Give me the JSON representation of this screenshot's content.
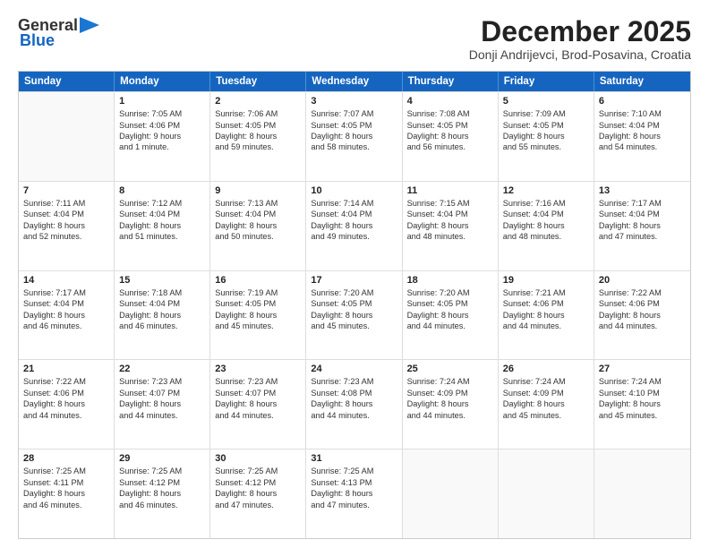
{
  "header": {
    "logo_line1": "General",
    "logo_line2": "Blue",
    "month": "December 2025",
    "location": "Donji Andrijevci, Brod-Posavina, Croatia"
  },
  "days": [
    "Sunday",
    "Monday",
    "Tuesday",
    "Wednesday",
    "Thursday",
    "Friday",
    "Saturday"
  ],
  "weeks": [
    [
      {
        "day": "",
        "content": []
      },
      {
        "day": "1",
        "content": [
          "Sunrise: 7:05 AM",
          "Sunset: 4:06 PM",
          "Daylight: 9 hours",
          "and 1 minute."
        ]
      },
      {
        "day": "2",
        "content": [
          "Sunrise: 7:06 AM",
          "Sunset: 4:05 PM",
          "Daylight: 8 hours",
          "and 59 minutes."
        ]
      },
      {
        "day": "3",
        "content": [
          "Sunrise: 7:07 AM",
          "Sunset: 4:05 PM",
          "Daylight: 8 hours",
          "and 58 minutes."
        ]
      },
      {
        "day": "4",
        "content": [
          "Sunrise: 7:08 AM",
          "Sunset: 4:05 PM",
          "Daylight: 8 hours",
          "and 56 minutes."
        ]
      },
      {
        "day": "5",
        "content": [
          "Sunrise: 7:09 AM",
          "Sunset: 4:05 PM",
          "Daylight: 8 hours",
          "and 55 minutes."
        ]
      },
      {
        "day": "6",
        "content": [
          "Sunrise: 7:10 AM",
          "Sunset: 4:04 PM",
          "Daylight: 8 hours",
          "and 54 minutes."
        ]
      }
    ],
    [
      {
        "day": "7",
        "content": [
          "Sunrise: 7:11 AM",
          "Sunset: 4:04 PM",
          "Daylight: 8 hours",
          "and 52 minutes."
        ]
      },
      {
        "day": "8",
        "content": [
          "Sunrise: 7:12 AM",
          "Sunset: 4:04 PM",
          "Daylight: 8 hours",
          "and 51 minutes."
        ]
      },
      {
        "day": "9",
        "content": [
          "Sunrise: 7:13 AM",
          "Sunset: 4:04 PM",
          "Daylight: 8 hours",
          "and 50 minutes."
        ]
      },
      {
        "day": "10",
        "content": [
          "Sunrise: 7:14 AM",
          "Sunset: 4:04 PM",
          "Daylight: 8 hours",
          "and 49 minutes."
        ]
      },
      {
        "day": "11",
        "content": [
          "Sunrise: 7:15 AM",
          "Sunset: 4:04 PM",
          "Daylight: 8 hours",
          "and 48 minutes."
        ]
      },
      {
        "day": "12",
        "content": [
          "Sunrise: 7:16 AM",
          "Sunset: 4:04 PM",
          "Daylight: 8 hours",
          "and 48 minutes."
        ]
      },
      {
        "day": "13",
        "content": [
          "Sunrise: 7:17 AM",
          "Sunset: 4:04 PM",
          "Daylight: 8 hours",
          "and 47 minutes."
        ]
      }
    ],
    [
      {
        "day": "14",
        "content": [
          "Sunrise: 7:17 AM",
          "Sunset: 4:04 PM",
          "Daylight: 8 hours",
          "and 46 minutes."
        ]
      },
      {
        "day": "15",
        "content": [
          "Sunrise: 7:18 AM",
          "Sunset: 4:04 PM",
          "Daylight: 8 hours",
          "and 46 minutes."
        ]
      },
      {
        "day": "16",
        "content": [
          "Sunrise: 7:19 AM",
          "Sunset: 4:05 PM",
          "Daylight: 8 hours",
          "and 45 minutes."
        ]
      },
      {
        "day": "17",
        "content": [
          "Sunrise: 7:20 AM",
          "Sunset: 4:05 PM",
          "Daylight: 8 hours",
          "and 45 minutes."
        ]
      },
      {
        "day": "18",
        "content": [
          "Sunrise: 7:20 AM",
          "Sunset: 4:05 PM",
          "Daylight: 8 hours",
          "and 44 minutes."
        ]
      },
      {
        "day": "19",
        "content": [
          "Sunrise: 7:21 AM",
          "Sunset: 4:06 PM",
          "Daylight: 8 hours",
          "and 44 minutes."
        ]
      },
      {
        "day": "20",
        "content": [
          "Sunrise: 7:22 AM",
          "Sunset: 4:06 PM",
          "Daylight: 8 hours",
          "and 44 minutes."
        ]
      }
    ],
    [
      {
        "day": "21",
        "content": [
          "Sunrise: 7:22 AM",
          "Sunset: 4:06 PM",
          "Daylight: 8 hours",
          "and 44 minutes."
        ]
      },
      {
        "day": "22",
        "content": [
          "Sunrise: 7:23 AM",
          "Sunset: 4:07 PM",
          "Daylight: 8 hours",
          "and 44 minutes."
        ]
      },
      {
        "day": "23",
        "content": [
          "Sunrise: 7:23 AM",
          "Sunset: 4:07 PM",
          "Daylight: 8 hours",
          "and 44 minutes."
        ]
      },
      {
        "day": "24",
        "content": [
          "Sunrise: 7:23 AM",
          "Sunset: 4:08 PM",
          "Daylight: 8 hours",
          "and 44 minutes."
        ]
      },
      {
        "day": "25",
        "content": [
          "Sunrise: 7:24 AM",
          "Sunset: 4:09 PM",
          "Daylight: 8 hours",
          "and 44 minutes."
        ]
      },
      {
        "day": "26",
        "content": [
          "Sunrise: 7:24 AM",
          "Sunset: 4:09 PM",
          "Daylight: 8 hours",
          "and 45 minutes."
        ]
      },
      {
        "day": "27",
        "content": [
          "Sunrise: 7:24 AM",
          "Sunset: 4:10 PM",
          "Daylight: 8 hours",
          "and 45 minutes."
        ]
      }
    ],
    [
      {
        "day": "28",
        "content": [
          "Sunrise: 7:25 AM",
          "Sunset: 4:11 PM",
          "Daylight: 8 hours",
          "and 46 minutes."
        ]
      },
      {
        "day": "29",
        "content": [
          "Sunrise: 7:25 AM",
          "Sunset: 4:12 PM",
          "Daylight: 8 hours",
          "and 46 minutes."
        ]
      },
      {
        "day": "30",
        "content": [
          "Sunrise: 7:25 AM",
          "Sunset: 4:12 PM",
          "Daylight: 8 hours",
          "and 47 minutes."
        ]
      },
      {
        "day": "31",
        "content": [
          "Sunrise: 7:25 AM",
          "Sunset: 4:13 PM",
          "Daylight: 8 hours",
          "and 47 minutes."
        ]
      },
      {
        "day": "",
        "content": []
      },
      {
        "day": "",
        "content": []
      },
      {
        "day": "",
        "content": []
      }
    ]
  ]
}
